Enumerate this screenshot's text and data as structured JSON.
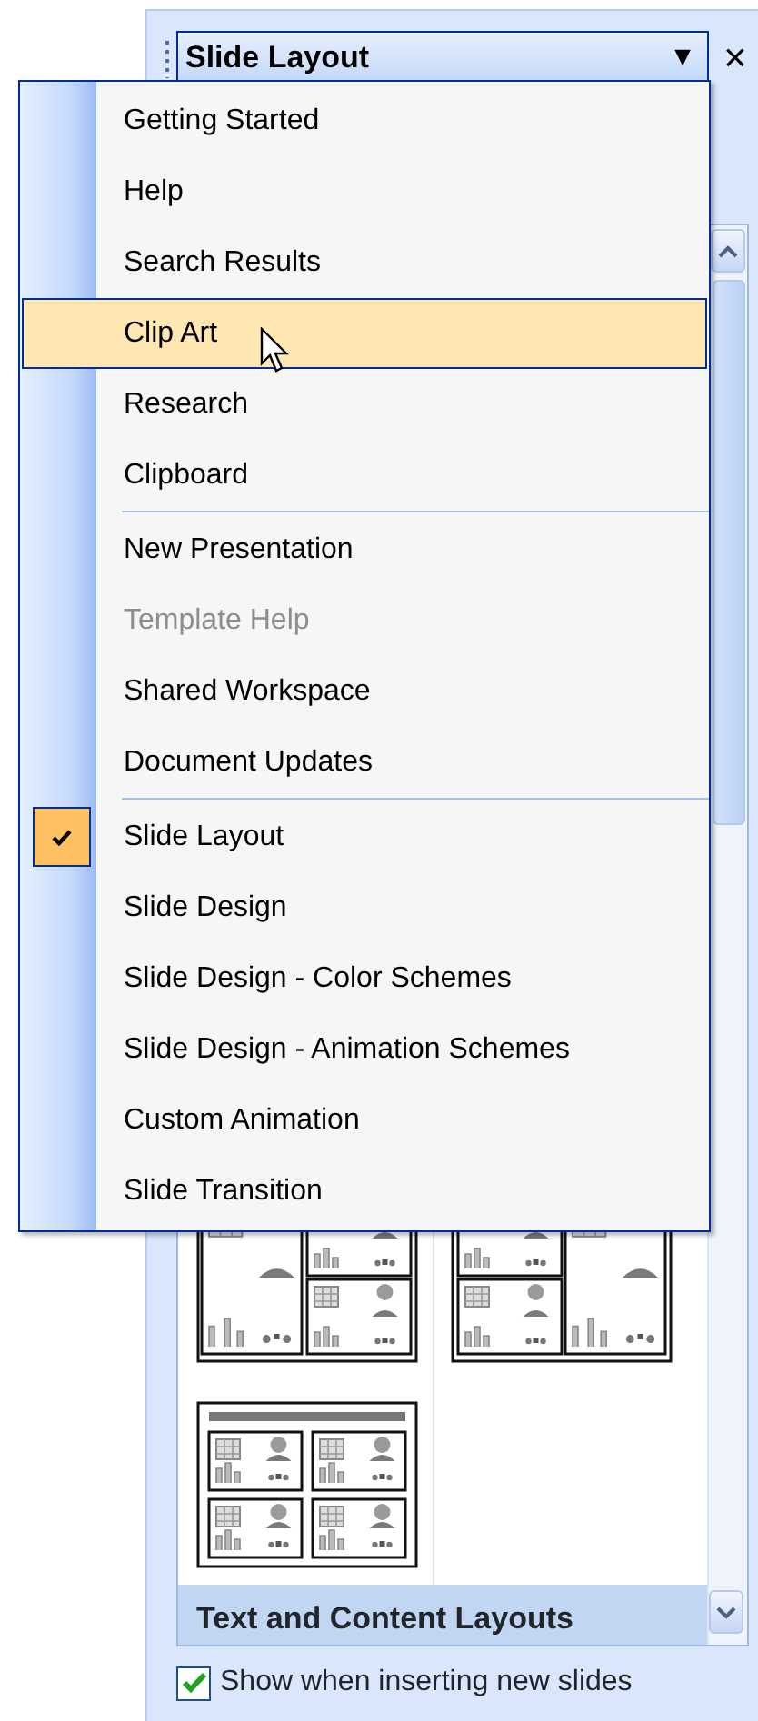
{
  "task_pane": {
    "title": "Slide Layout",
    "dropdown_glyph": "▼",
    "close_glyph": "×",
    "layouts": [
      {
        "kind": "large-left"
      },
      {
        "kind": "large-right"
      },
      {
        "kind": "title-four"
      }
    ],
    "section_header": "Text and Content Layouts",
    "show_checkbox": {
      "label": "Show when inserting new slides",
      "checked": true
    }
  },
  "menu": {
    "groups": [
      [
        {
          "label": "Getting Started",
          "selected": false,
          "checked": false,
          "disabled": false
        },
        {
          "label": "Help",
          "selected": false,
          "checked": false,
          "disabled": false
        },
        {
          "label": "Search Results",
          "selected": false,
          "checked": false,
          "disabled": false
        },
        {
          "label": "Clip Art",
          "selected": true,
          "checked": false,
          "disabled": false
        },
        {
          "label": "Research",
          "selected": false,
          "checked": false,
          "disabled": false
        },
        {
          "label": "Clipboard",
          "selected": false,
          "checked": false,
          "disabled": false
        }
      ],
      [
        {
          "label": "New Presentation",
          "selected": false,
          "checked": false,
          "disabled": false
        },
        {
          "label": "Template Help",
          "selected": false,
          "checked": false,
          "disabled": true
        },
        {
          "label": "Shared Workspace",
          "selected": false,
          "checked": false,
          "disabled": false
        },
        {
          "label": "Document Updates",
          "selected": false,
          "checked": false,
          "disabled": false
        }
      ],
      [
        {
          "label": "Slide Layout",
          "selected": false,
          "checked": true,
          "disabled": false
        },
        {
          "label": "Slide Design",
          "selected": false,
          "checked": false,
          "disabled": false
        },
        {
          "label": "Slide Design - Color Schemes",
          "selected": false,
          "checked": false,
          "disabled": false
        },
        {
          "label": "Slide Design - Animation Schemes",
          "selected": false,
          "checked": false,
          "disabled": false
        },
        {
          "label": "Custom Animation",
          "selected": false,
          "checked": false,
          "disabled": false
        },
        {
          "label": "Slide Transition",
          "selected": false,
          "checked": false,
          "disabled": false
        }
      ]
    ]
  }
}
